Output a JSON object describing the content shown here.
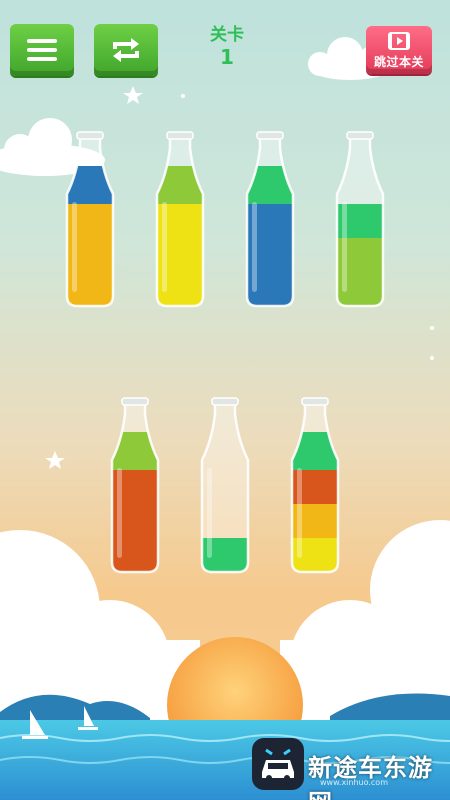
{
  "hud": {
    "menu_icon": "hamburger-menu-icon",
    "restart_icon": "restart-arrows-icon",
    "level_title": "关卡",
    "level_number": "1",
    "skip_label": "跳过本关",
    "skip_icon": "video-play-icon"
  },
  "colors": {
    "blue": "#2a78b8",
    "yellow": "#f1b716",
    "lime_yellow": "#efe214",
    "green": "#2ec96c",
    "lime": "#8ec93a",
    "orange": "#d8551b",
    "button_green": "#4cb52f",
    "button_red": "#e33a59"
  },
  "bottles": [
    {
      "layers": [
        "yellow",
        "yellow",
        "yellow",
        "blue"
      ]
    },
    {
      "layers": [
        "lime_yellow",
        "lime_yellow",
        "lime_yellow",
        "lime"
      ]
    },
    {
      "layers": [
        "blue",
        "blue",
        "blue",
        "green"
      ]
    },
    {
      "layers": [
        "lime",
        "lime",
        "green"
      ]
    },
    {
      "layers": [
        "orange",
        "orange",
        "orange",
        "lime"
      ]
    },
    {
      "layers": [
        "green"
      ]
    },
    {
      "layers": [
        "lime_yellow",
        "yellow",
        "orange",
        "green"
      ]
    }
  ],
  "watermark": {
    "text": "新途车东游网",
    "url": "www.xinhuo.com"
  }
}
